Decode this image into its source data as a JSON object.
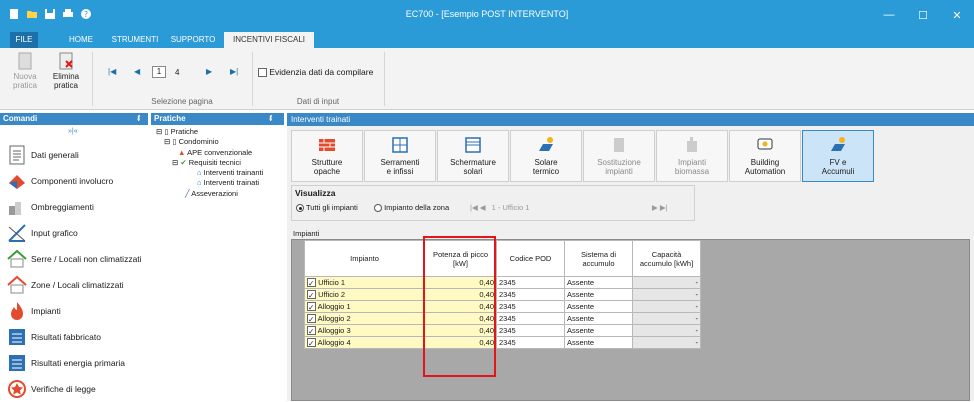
{
  "window": {
    "title": "EC700 - [Esempio POST INTERVENTO]",
    "controls": [
      "—",
      "☐",
      "✕"
    ]
  },
  "menu": {
    "tabs": [
      "FILE",
      "HOME",
      "STRUMENTI",
      "SUPPORTO",
      "INCENTIVI FISCALI"
    ]
  },
  "ribbon": {
    "new_label_1": "Nuova",
    "new_label_2": "pratica",
    "delete_label_1": "Elimina",
    "delete_label_2": "pratica",
    "page_current": "1",
    "page_total": "4",
    "page_group_label": "Selezione pagina",
    "highlight_label": "Evidenzia dati da compilare",
    "input_group_label": "Dati di input"
  },
  "left_panel": {
    "title": "Comandi",
    "pin": "ᵮ",
    "collapse": "»|«",
    "items": [
      {
        "label": "Dati generali"
      },
      {
        "label": "Componenti involucro"
      },
      {
        "label": "Ombreggiamenti"
      },
      {
        "label": "Input grafico"
      },
      {
        "label": "Serre / Locali non climatizzati"
      },
      {
        "label": "Zone / Locali climatizzati"
      },
      {
        "label": "Impianti"
      },
      {
        "label": "Risultati fabbricato"
      },
      {
        "label": "Risultati energia primaria"
      },
      {
        "label": "Verifiche di legge"
      }
    ]
  },
  "tree": {
    "title": "Pratiche",
    "pin": "ᵮ",
    "nodes": [
      "Pratiche",
      "Condominio",
      "APE convenzionale",
      "Requisiti tecnici",
      "Interventi trainanti",
      "Interventi trainati",
      "Asseverazioni"
    ]
  },
  "main": {
    "title": "Interventi trainati",
    "toolbar": [
      {
        "line1": "Strutture",
        "line2": "opache"
      },
      {
        "line1": "Serramenti",
        "line2": "e infissi"
      },
      {
        "line1": "Schermature",
        "line2": "solari"
      },
      {
        "line1": "Solare",
        "line2": "termico"
      },
      {
        "line1": "Sostituzione",
        "line2": "impianti"
      },
      {
        "line1": "Impianti",
        "line2": "biomassa"
      },
      {
        "line1": "Building",
        "line2": "Automation"
      },
      {
        "line1": "FV e",
        "line2": "Accumuli"
      }
    ],
    "visualizza": {
      "title": "Visualizza",
      "opt_all": "Tutti gli impianti",
      "opt_zone": "Impianto della zona",
      "zone_value": "1 - Ufficio 1"
    },
    "impianti_label": "Impianti",
    "table": {
      "headers": [
        "Impianto",
        "Potenza di picco [kW]",
        "Codice POD",
        "Sistema di accumulo",
        "Capacità accumulo [kWh]"
      ],
      "rows": [
        {
          "name": "Ufficio 1",
          "pot": "0,40",
          "pod": "2345",
          "sys": "Assente",
          "cap": "-"
        },
        {
          "name": "Ufficio 2",
          "pot": "0,40",
          "pod": "2345",
          "sys": "Assente",
          "cap": "-"
        },
        {
          "name": "Alloggio 1",
          "pot": "0,40",
          "pod": "2345",
          "sys": "Assente",
          "cap": "-"
        },
        {
          "name": "Alloggio 2",
          "pot": "0,40",
          "pod": "2345",
          "sys": "Assente",
          "cap": "-"
        },
        {
          "name": "Alloggio 3",
          "pot": "0,40",
          "pod": "2345",
          "sys": "Assente",
          "cap": "-"
        },
        {
          "name": "Alloggio 4",
          "pot": "0,40",
          "pod": "2345",
          "sys": "Assente",
          "cap": "-"
        }
      ]
    }
  },
  "colors": {
    "accent": "#2b9bd8",
    "panel_header": "#3a88c6",
    "highlight_yellow": "#fff9c4",
    "callout_red": "#e3141a"
  }
}
